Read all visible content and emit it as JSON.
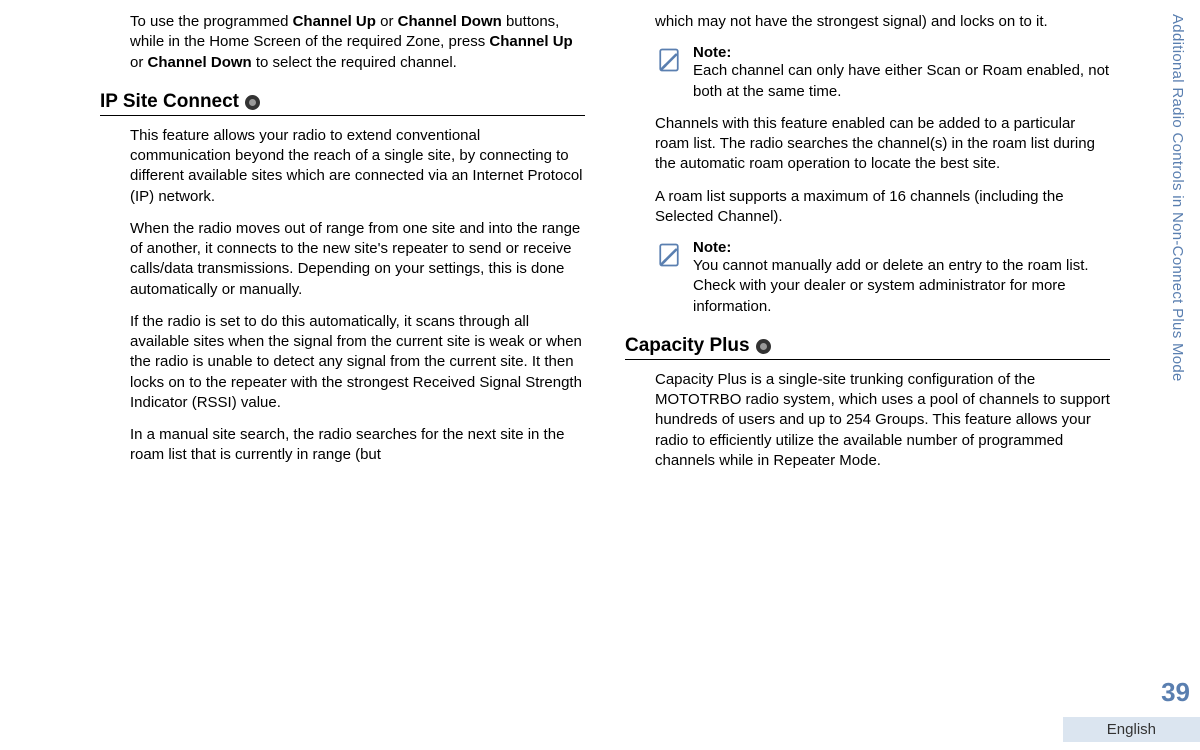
{
  "left": {
    "intro_html": "To use the programmed <b>Channel Up</b> or <b>Channel Down</b> buttons, while in the Home Screen of the required Zone, press <b>Channel Up</b> or <b>Channel Down</b> to select the required channel.",
    "heading1": "IP Site Connect",
    "p1": "This feature allows your radio to extend conventional communication beyond the reach of a single site, by connecting to different available sites which are connected via an Internet Protocol (IP) network.",
    "p2": "When the radio moves out of range from one site and into the range of another, it connects to the new site's repeater to send or receive calls/data transmissions. Depending on your settings, this is done automatically or manually.",
    "p3": "If the radio is set to do this automatically, it scans through all available sites when the signal from the current site is weak or when the radio is unable to detect any signal from the current site. It then locks on to the repeater with the strongest Received Signal Strength Indicator (RSSI) value.",
    "p4": "In a manual site search, the radio searches for the next site in the roam list that is currently in range (but"
  },
  "right": {
    "cont": "which may not have the strongest signal) and locks on to it.",
    "note1_label": "Note:",
    "note1_text": "Each channel can only have either Scan or Roam enabled, not both at the same time.",
    "p1": "Channels with this feature enabled can be added to a particular roam list. The radio searches the channel(s) in the roam list during the automatic roam operation to locate the best site.",
    "p2": "A roam list supports a maximum of 16 channels (including the Selected Channel).",
    "note2_label": "Note:",
    "note2_text": "You cannot manually add or delete an entry to the roam list. Check with your dealer or system administrator for more information.",
    "heading2": "Capacity Plus",
    "p3": "Capacity Plus is a single-site trunking configuration of the MOTOTRBO radio system, which uses a pool of channels to support hundreds of users and up to 254 Groups. This feature allows your radio to efficiently utilize the available number of programmed channels while in Repeater Mode."
  },
  "side_label": "Additional Radio Controls in Non-Connect Plus Mode",
  "page_number": "39",
  "language": "English"
}
